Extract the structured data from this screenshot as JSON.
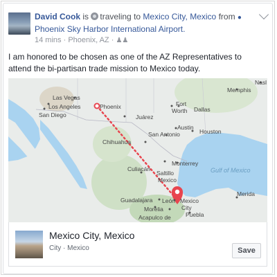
{
  "post": {
    "author": "David Cook",
    "is_text": "is",
    "activity": "traveling to",
    "destination": "Mexico City, Mexico",
    "from_text": "from",
    "origin": "Phoenix Sky Harbor International Airport.",
    "time": "14 mins",
    "location": "Phoenix, AZ",
    "message": "I am honored to be chosen as one of the AZ Representatives to attend the bi-partisan trade mission to Mexico today."
  },
  "map": {
    "labels": {
      "las_vegas": "Las Vegas",
      "los_angeles": "Los Angeles",
      "san_diego": "San Diego",
      "phoenix": "Phoenix",
      "memphis": "Memphis",
      "nashville": "Nasl",
      "fort_worth": "Fort",
      "worth": "Worth",
      "dallas": "Dallas",
      "juarez": "Juárez",
      "austin": "Austin",
      "houston": "Houston",
      "san_antonio": "San Antonio",
      "chihuahua": "Chihuahua",
      "monterrey": "Monterrey",
      "saltillo": "Saltillo",
      "gulf": "Gulf of Mexico",
      "culiacan": "Culiacán",
      "mexico": "Mexico",
      "guadalajara": "Guadalajara",
      "leon": "León",
      "mexico_city_a": "Mexico",
      "mexico_city_b": "City",
      "merida": "Merida",
      "morelia": "Morelia",
      "acapulco": "Acapulco de",
      "puebla": "Puebla"
    },
    "colors": {
      "water": "#a9d3f0",
      "land": "#e9ecea",
      "route": "#e8454f",
      "pin": "#e8454f"
    }
  },
  "place": {
    "title": "Mexico City, Mexico",
    "subtitle": "City · Mexico",
    "save_label": "Save"
  },
  "icons": {
    "travel": "travel-icon",
    "pin": "location-pin-icon",
    "privacy": "people-icon",
    "menu": "chevron-down-icon"
  }
}
